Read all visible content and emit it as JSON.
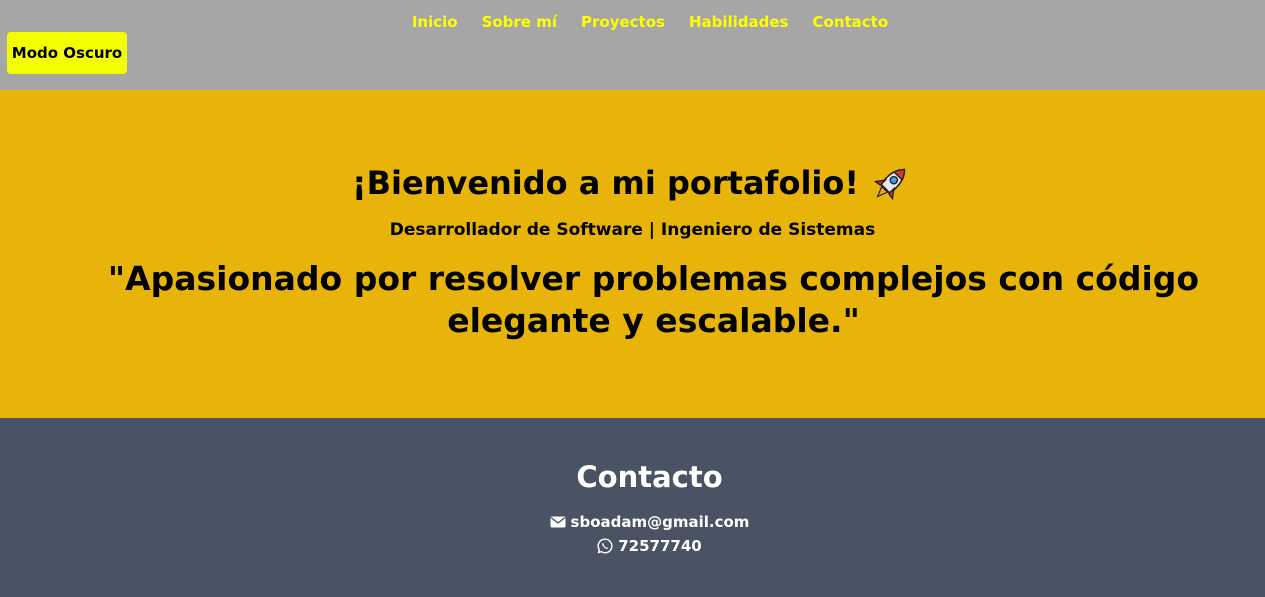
{
  "navbar": {
    "links": [
      {
        "label": "Inicio"
      },
      {
        "label": "Sobre mí"
      },
      {
        "label": "Proyectos"
      },
      {
        "label": "Habilidades"
      },
      {
        "label": "Contacto"
      }
    ],
    "dark_mode_label": "Modo Oscuro"
  },
  "hero": {
    "title": "¡Bienvenido a mi portafolio!",
    "title_icon": "rocket-icon",
    "subtitle": "Desarrollador de Software | Ingeniero de Sistemas",
    "quote": "\"Apasionado por resolver problemas complejos con código elegante y escalable.\""
  },
  "contact": {
    "title": "Contacto",
    "email": {
      "icon": "envelope-icon",
      "value": "sboadam@gmail.com"
    },
    "phone": {
      "icon": "whatsapp-icon",
      "value": "72577740"
    }
  },
  "colors": {
    "navbar_bg": "#a6a6a6",
    "nav_link": "#ffff00",
    "button_bg": "#f3ff00",
    "hero_bg": "#e8b409",
    "contact_bg": "#4a5363"
  }
}
